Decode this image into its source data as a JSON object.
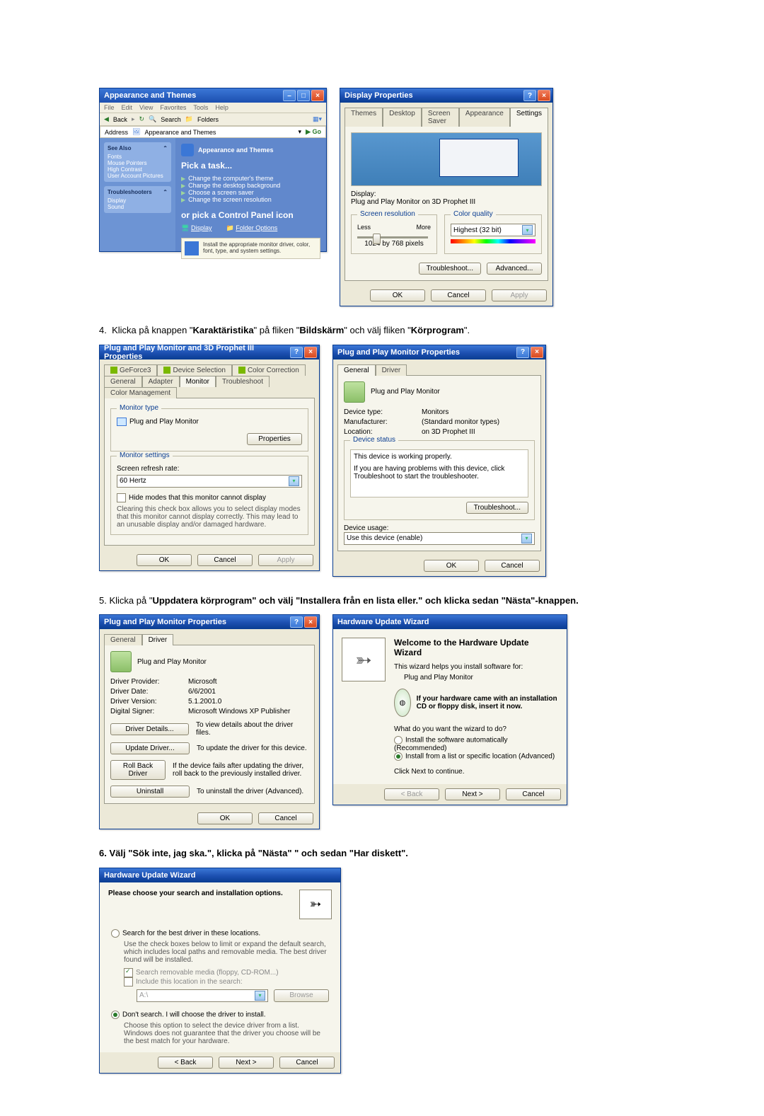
{
  "cp": {
    "title": "Appearance and Themes",
    "menu": [
      "File",
      "Edit",
      "View",
      "Favorites",
      "Tools",
      "Help"
    ],
    "nav": {
      "back": "Back",
      "search": "Search",
      "folders": "Folders"
    },
    "addr_label": "Address",
    "addr_value": "Appearance and Themes",
    "go": "Go",
    "side": {
      "see_also": "See Also",
      "see_items": [
        "Fonts",
        "Mouse Pointers",
        "High Contrast",
        "User Account Pictures"
      ],
      "trouble": "Troubleshooters",
      "trouble_items": [
        "Display",
        "Sound"
      ]
    },
    "main": {
      "banner": "Appearance and Themes",
      "pick_task": "Pick a task...",
      "tasks": [
        "Change the computer's theme",
        "Change the desktop background",
        "Choose a screen saver",
        "Change the screen resolution"
      ],
      "or_pick": "or pick a Control Panel icon",
      "icons": {
        "display": "Display",
        "folder_options": "Folder Options"
      },
      "balloon": "Install the appropriate monitor driver, color, font, type, and system settings."
    }
  },
  "dp": {
    "title": "Display Properties",
    "tabs": [
      "Themes",
      "Desktop",
      "Screen Saver",
      "Appearance",
      "Settings"
    ],
    "display_label": "Display:",
    "display_value": "Plug and Play Monitor on 3D Prophet III",
    "res_group": "Screen resolution",
    "less": "Less",
    "more": "More",
    "res_value": "1024 by 768 pixels",
    "cq_group": "Color quality",
    "cq_value": "Highest (32 bit)",
    "troubleshoot": "Troubleshoot...",
    "advanced": "Advanced...",
    "ok": "OK",
    "cancel": "Cancel",
    "apply": "Apply"
  },
  "step4": "4.  Klicka på knappen \"Karaktäristika\" på fliken \"Bildskärm\" och välj fliken \"Körprogram\".",
  "step4_bold": {
    "a": "Karaktäristika",
    "b": "Bildskärm",
    "c": "Körprogram"
  },
  "adv": {
    "title": "Plug and Play Monitor and 3D Prophet III Properties",
    "tabs_row1": [
      "GeForce3",
      "Device Selection",
      "Color Correction"
    ],
    "tabs_row2": [
      "General",
      "Adapter",
      "Monitor",
      "Troubleshoot",
      "Color Management"
    ],
    "mtype_group": "Monitor type",
    "mtype_value": "Plug and Play Monitor",
    "properties": "Properties",
    "mset_group": "Monitor settings",
    "refresh_label": "Screen refresh rate:",
    "refresh_value": "60 Hertz",
    "hide_modes": "Hide modes that this monitor cannot display",
    "hide_desc": "Clearing this check box allows you to select display modes that this monitor cannot display correctly. This may lead to an unusable display and/or damaged hardware.",
    "ok": "OK",
    "cancel": "Cancel",
    "apply": "Apply"
  },
  "pnp1": {
    "title": "Plug and Play Monitor Properties",
    "tabs": [
      "General",
      "Driver"
    ],
    "name": "Plug and Play Monitor",
    "devtype_k": "Device type:",
    "devtype_v": "Monitors",
    "manu_k": "Manufacturer:",
    "manu_v": "(Standard monitor types)",
    "loc_k": "Location:",
    "loc_v": "on 3D Prophet III",
    "status_group": "Device status",
    "status_text": "This device is working properly.",
    "status_hint": "If you are having problems with this device, click Troubleshoot to start the troubleshooter.",
    "troubleshoot": "Troubleshoot...",
    "usage_label": "Device usage:",
    "usage_value": "Use this device (enable)",
    "ok": "OK",
    "cancel": "Cancel"
  },
  "step5_a": "5.  Klicka på \"",
  "step5_b": "Uppdatera körprogram\" och välj \"Installera från en lista eller.\" och klicka sedan \"Nästa\"-knappen.",
  "pnp2": {
    "title": "Plug and Play Monitor Properties",
    "tabs": [
      "General",
      "Driver"
    ],
    "name": "Plug and Play Monitor",
    "prov_k": "Driver Provider:",
    "prov_v": "Microsoft",
    "date_k": "Driver Date:",
    "date_v": "6/6/2001",
    "ver_k": "Driver Version:",
    "ver_v": "5.1.2001.0",
    "sign_k": "Digital Signer:",
    "sign_v": "Microsoft Windows XP Publisher",
    "b_details": "Driver Details...",
    "b_details_d": "To view details about the driver files.",
    "b_update": "Update Driver...",
    "b_update_d": "To update the driver for this device.",
    "b_roll": "Roll Back Driver",
    "b_roll_d": "If the device fails after updating the driver, roll back to the previously installed driver.",
    "b_uninstall": "Uninstall",
    "b_uninstall_d": "To uninstall the driver (Advanced).",
    "ok": "OK",
    "cancel": "Cancel"
  },
  "wiz1": {
    "title": "Hardware Update Wizard",
    "welcome": "Welcome to the Hardware Update Wizard",
    "intro": "This wizard helps you install software for:",
    "device": "Plug and Play Monitor",
    "cd_hint": "If your hardware came with an installation CD or floppy disk, insert it now.",
    "q": "What do you want the wizard to do?",
    "opt_auto": "Install the software automatically (Recommended)",
    "opt_list": "Install from a list or specific location (Advanced)",
    "cont": "Click Next to continue.",
    "back": "< Back",
    "next": "Next >",
    "cancel": "Cancel"
  },
  "step6": "6.  Välj \"Sök inte, jag ska.\", klicka på \"Nästa\" \" och sedan \"Har diskett\".",
  "wiz2": {
    "title": "Hardware Update Wizard",
    "header": "Please choose your search and installation options.",
    "opt_search": "Search for the best driver in these locations.",
    "search_desc": "Use the check boxes below to limit or expand the default search, which includes local paths and removable media. The best driver found will be installed.",
    "chk_media": "Search removable media (floppy, CD-ROM...)",
    "chk_loc": "Include this location in the search:",
    "loc_value": "A:\\",
    "browse": "Browse",
    "opt_dont": "Don't search. I will choose the driver to install.",
    "dont_desc": "Choose this option to select the device driver from a list. Windows does not guarantee that the driver you choose will be the best match for your hardware.",
    "back": "< Back",
    "next": "Next >",
    "cancel": "Cancel"
  }
}
